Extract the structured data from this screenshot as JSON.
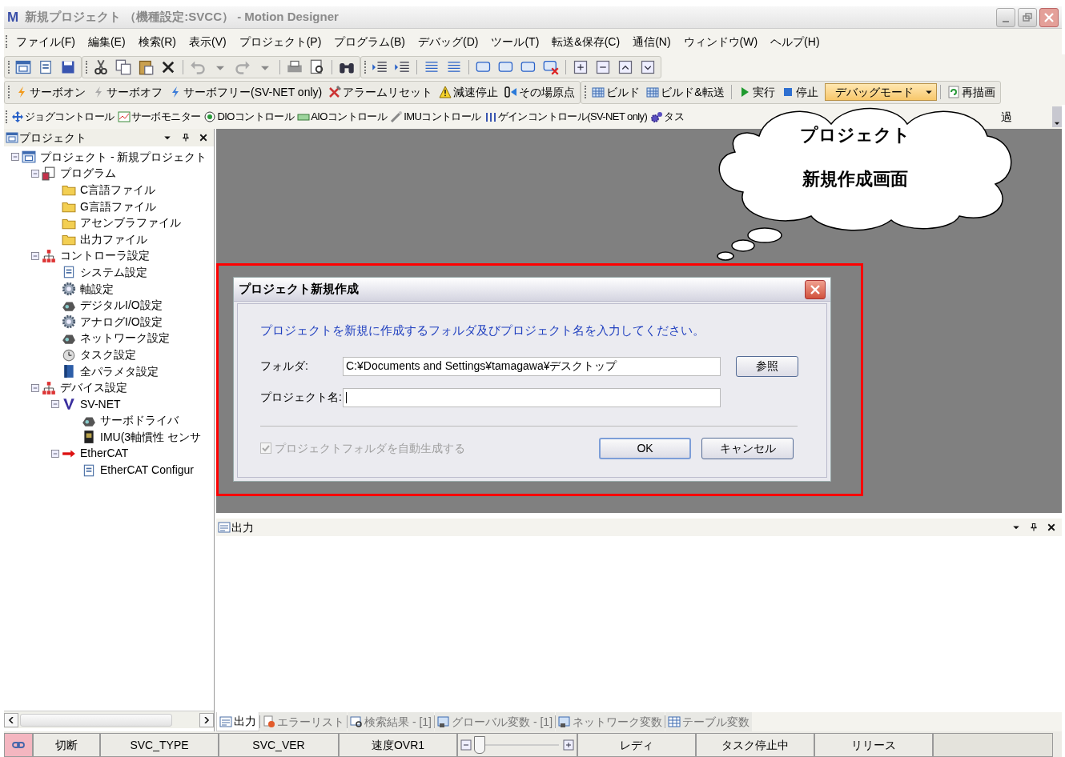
{
  "window": {
    "logo": "M",
    "title": "新規プロジェクト （機種設定:SVCC） - Motion Designer"
  },
  "menu": [
    "ファイル(F)",
    "編集(E)",
    "検索(R)",
    "表示(V)",
    "プロジェクト(P)",
    "プログラム(B)",
    "デバッグ(D)",
    "ツール(T)",
    "転送&保存(C)",
    "通信(N)",
    "ウィンドウ(W)",
    "ヘルプ(H)"
  ],
  "toolbar_2": [
    [
      {
        "label": "サーボオン",
        "kind": "bolt-orange"
      },
      {
        "label": "サーボオフ",
        "kind": "bolt-gray"
      },
      {
        "label": "サーボフリー(SV-NET only)",
        "kind": "bolt-blue"
      },
      {
        "label": "アラームリセット",
        "kind": "tools"
      },
      {
        "label": "減速停止",
        "kind": "warning"
      },
      {
        "label": "その場原点",
        "kind": "origin"
      }
    ],
    [
      {
        "label": "ビルド",
        "kind": "grid"
      },
      {
        "label": "ビルド&転送",
        "kind": "grid"
      }
    ],
    [
      {
        "label": "実行",
        "kind": "play"
      },
      {
        "label": "停止",
        "kind": "stop"
      }
    ]
  ],
  "mode_dropdown": {
    "value": "デバッグモード"
  },
  "redraw": {
    "label": "再描画"
  },
  "toolbar_3": [
    {
      "label": "ジョグコントロール",
      "kind": "move"
    },
    {
      "label": "サーボモニター",
      "kind": "monitor"
    },
    {
      "label": "DIOコントロール",
      "kind": "radio"
    },
    {
      "label": "AIOコントロール",
      "kind": "battery"
    },
    {
      "label": "IMUコントロール",
      "kind": "probe"
    },
    {
      "label": "ゲインコントロール(SV-NET only)",
      "kind": "bars"
    },
    {
      "label": "タス",
      "kind": "gears"
    }
  ],
  "toolbar_3_right": "過",
  "callout": {
    "lines": [
      "プロジェクト",
      "新規作成画面"
    ]
  },
  "project_panel": {
    "title": "プロジェクト",
    "tree": [
      {
        "label": "プロジェクト - 新規プロジェクト",
        "kind": "project",
        "expanded": true,
        "children": [
          {
            "label": "プログラム",
            "kind": "program",
            "expanded": true,
            "children": [
              {
                "label": "C言語ファイル",
                "kind": "folder"
              },
              {
                "label": "G言語ファイル",
                "kind": "folder"
              },
              {
                "label": "アセンブラファイル",
                "kind": "folder"
              },
              {
                "label": "出力ファイル",
                "kind": "folder"
              }
            ]
          },
          {
            "label": "コントローラ設定",
            "kind": "network",
            "expanded": true,
            "children": [
              {
                "label": "システム設定",
                "kind": "document"
              },
              {
                "label": "軸設定",
                "kind": "gear"
              },
              {
                "label": "デジタルI/O設定",
                "kind": "device"
              },
              {
                "label": "アナログI/O設定",
                "kind": "gear"
              },
              {
                "label": "ネットワーク設定",
                "kind": "device"
              },
              {
                "label": "タスク設定",
                "kind": "clock"
              },
              {
                "label": "全パラメタ設定",
                "kind": "book"
              }
            ]
          },
          {
            "label": "デバイス設定",
            "kind": "network",
            "expanded": true,
            "children": [
              {
                "label": "SV-NET",
                "kind": "v",
                "expanded": true,
                "children": [
                  {
                    "label": "サーボドライバ",
                    "kind": "device"
                  },
                  {
                    "label": "IMU(3軸慣性 センサ",
                    "kind": "chip"
                  }
                ]
              },
              {
                "label": "EtherCAT",
                "kind": "arrow",
                "expanded": true,
                "children": [
                  {
                    "label": "EtherCAT Configur",
                    "kind": "document"
                  }
                ]
              }
            ]
          }
        ]
      }
    ]
  },
  "dialog": {
    "title": "プロジェクト新規作成",
    "message": "プロジェクトを新規に作成するフォルダ及びプロジェクト名を入力してください。",
    "folder_label": "フォルダ:",
    "folder_value": "C:¥Documents and Settings¥tamagawa¥デスクトップ",
    "browse_button": "参照",
    "name_label": "プロジェクト名:",
    "auto_folder": {
      "label": "プロジェクトフォルダを自動生成する",
      "checked": true,
      "disabled": true
    },
    "buttons": [
      "OK",
      "キャンセル"
    ]
  },
  "output_panel": {
    "title": "出力"
  },
  "bottom_tabs": [
    {
      "label": "出力",
      "selected": true,
      "kind": "output"
    },
    {
      "label": "エラーリスト",
      "selected": false,
      "kind": "error"
    },
    {
      "label": "検索結果 - [1]",
      "selected": false,
      "kind": "search"
    },
    {
      "label": "グローバル変数 - [1]",
      "selected": false,
      "kind": "vars"
    },
    {
      "label": "ネットワーク変数",
      "selected": false,
      "kind": "vars"
    },
    {
      "label": "テーブル変数",
      "selected": false,
      "kind": "table"
    }
  ],
  "status_bar": [
    {
      "kind": "link"
    },
    {
      "kind": "text",
      "text": "切断"
    },
    {
      "kind": "text",
      "text": "SVC_TYPE"
    },
    {
      "kind": "text",
      "text": "SVC_VER"
    },
    {
      "kind": "text",
      "text": "速度OVR1"
    },
    {
      "kind": "slider",
      "level": 0.05
    },
    {
      "kind": "text",
      "text": "レディ"
    },
    {
      "kind": "text",
      "text": "タスク停止中"
    },
    {
      "kind": "text",
      "text": "リリース"
    },
    {
      "kind": "empty"
    }
  ]
}
